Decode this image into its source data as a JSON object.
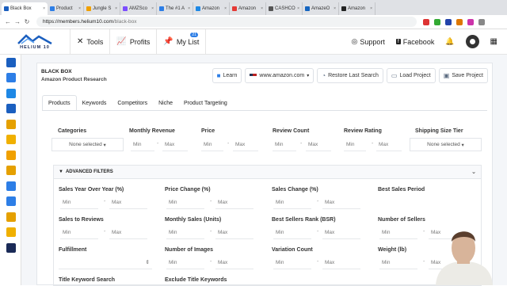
{
  "browser": {
    "tabs": [
      {
        "label": "Black Box",
        "color": "#1b5fbf",
        "active": true
      },
      {
        "label": "Product",
        "color": "#2d7ee6"
      },
      {
        "label": "Jungle S",
        "color": "#f0a000"
      },
      {
        "label": "AMZSco",
        "color": "#7c4dff"
      },
      {
        "label": "The #1 A",
        "color": "#2d7ee6"
      },
      {
        "label": "Amazon",
        "color": "#1e88e5"
      },
      {
        "label": "Amazon",
        "color": "#e53935"
      },
      {
        "label": "CASHCO",
        "color": "#555"
      },
      {
        "label": "AmazeO",
        "color": "#1565c0"
      },
      {
        "label": "Amazon",
        "color": "#222"
      }
    ],
    "url_host": "https://members.helium10.com",
    "url_path": "/black-box",
    "back": "←",
    "forward": "→",
    "reload": "↻",
    "ext_colors": [
      "#d33",
      "#3a3",
      "#24a",
      "#d70",
      "#c3a",
      "#888"
    ]
  },
  "header": {
    "logo_text": "HELIUM 10",
    "tools": "Tools",
    "profits": "Profits",
    "mylist": "My List",
    "mylist_badge": "21",
    "support": "Support",
    "facebook": "Facebook"
  },
  "sidebar_colors": [
    "#1b5fbf",
    "#2d7ee6",
    "#1e88e5",
    "#1b5fbf",
    "#e5a000",
    "#f0b000",
    "#f0a000",
    "#e5a000",
    "#2d7ee6",
    "#2d7ee6",
    "#e5a000",
    "#f0b000",
    "#1a2a57"
  ],
  "panel": {
    "title": "BLACK BOX",
    "subtitle": "Amazon Product Research",
    "learn": "Learn",
    "marketplace": "www.amazon.com",
    "restore": "Restore Last Search",
    "load": "Load Project",
    "save": "Save Project"
  },
  "tabs": [
    "Products",
    "Keywords",
    "Competitors",
    "Niche",
    "Product Targeting"
  ],
  "filters": {
    "categories": "Categories",
    "none_selected": "None selected",
    "monthly_revenue": "Monthly Revenue",
    "price": "Price",
    "review_count": "Review Count",
    "review_rating": "Review Rating",
    "shipping": "Shipping Size Tier",
    "min": "Min",
    "max": "Max"
  },
  "advanced": {
    "title": "ADVANCED FILTERS",
    "labels": [
      "Sales Year Over Year (%)",
      "Price Change (%)",
      "Sales Change (%)",
      "Best Sales Period",
      "Sales to Reviews",
      "Monthly Sales (Units)",
      "Best Sellers Rank (BSR)",
      "Number of Sellers",
      "Fulfillment",
      "Number of Images",
      "Variation Count",
      "Weight (lb)",
      "Title Keyword Search",
      "Exclude Title Keywords"
    ]
  }
}
